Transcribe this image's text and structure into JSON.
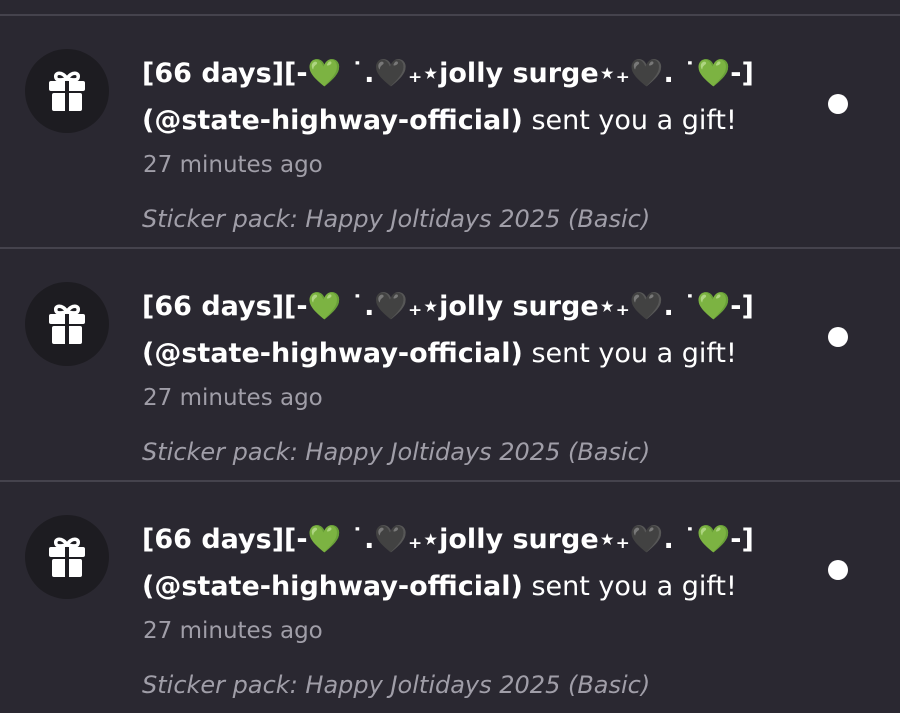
{
  "notifications": [
    {
      "title_strong": "[66 days][-💚 ˙.🖤₊⋆jolly surge⋆₊🖤. ˙💚-]",
      "title_handle": "(@state-highway-official)",
      "title_tail": " sent you a gift!",
      "time": "27 minutes ago",
      "detail": "Sticker pack: Happy Joltidays 2025 (Basic)",
      "icon": "gift-icon",
      "unread": true
    },
    {
      "title_strong": "[66 days][-💚 ˙.🖤₊⋆jolly surge⋆₊🖤. ˙💚-]",
      "title_handle": "(@state-highway-official)",
      "title_tail": " sent you a gift!",
      "time": "27 minutes ago",
      "detail": "Sticker pack: Happy Joltidays 2025 (Basic)",
      "icon": "gift-icon",
      "unread": true
    },
    {
      "title_strong": "[66 days][-💚 ˙.🖤₊⋆jolly surge⋆₊🖤. ˙💚-]",
      "title_handle": "(@state-highway-official)",
      "title_tail": " sent you a gift!",
      "time": "27 minutes ago",
      "detail": "Sticker pack: Happy Joltidays 2025 (Basic)",
      "icon": "gift-icon",
      "unread": true
    }
  ],
  "colors": {
    "background": "#2a2831",
    "divider": "#45434d",
    "avatar_bg": "#1d1c21",
    "primary_text": "#ffffff",
    "secondary_text": "#a09ea8",
    "unread_dot": "#ffffff"
  }
}
